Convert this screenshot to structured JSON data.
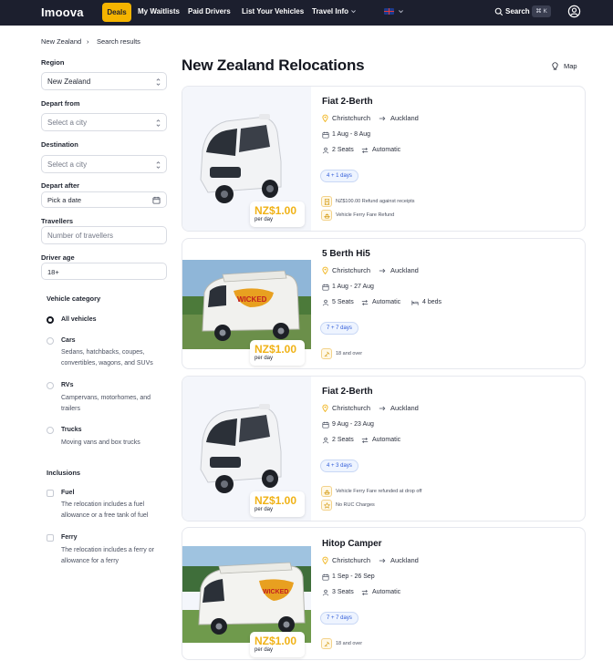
{
  "nav": {
    "logo": "Imoova",
    "deals": "Deals",
    "waitlists": "My Waitlists",
    "paid_drivers": "Paid Drivers",
    "list_vehicles": "List Your Vehicles",
    "travel_info": "Travel Info",
    "search": "Search",
    "shortcut": "⌘ K"
  },
  "breadcrumb": {
    "home": "New Zealand",
    "sep": "›",
    "current": "Search results"
  },
  "filters": {
    "region_label": "Region",
    "region_value": "New Zealand",
    "depart_from_label": "Depart from",
    "depart_from_placeholder": "Select a city",
    "destination_label": "Destination",
    "destination_placeholder": "Select a city",
    "depart_after_label": "Depart after",
    "depart_after_placeholder": "Pick a date",
    "travellers_label": "Travellers",
    "travellers_placeholder": "Number of travellers",
    "driver_age_label": "Driver age",
    "driver_age_value": "18+"
  },
  "vehicle_category": {
    "heading": "Vehicle category",
    "options": [
      {
        "title": "All vehicles",
        "desc": ""
      },
      {
        "title": "Cars",
        "desc": "Sedans, hatchbacks, coupes, convertibles, wagons, and SUVs"
      },
      {
        "title": "RVs",
        "desc": "Campervans, motorhomes, and trailers"
      },
      {
        "title": "Trucks",
        "desc": "Moving vans and box trucks"
      }
    ]
  },
  "inclusions": {
    "heading": "Inclusions",
    "options": [
      {
        "title": "Fuel",
        "desc": "The relocation includes a fuel allowance or a free tank of fuel"
      },
      {
        "title": "Ferry",
        "desc": "The relocation includes a ferry or allowance for a ferry"
      }
    ]
  },
  "main": {
    "title": "New Zealand Relocations",
    "map": "Map"
  },
  "listings": [
    {
      "title": "Fiat 2-Berth",
      "from": "Christchurch",
      "to": "Auckland",
      "dates": "1 Aug - 8 Aug",
      "seats": "2 Seats",
      "transmission": "Automatic",
      "beds": "",
      "days": "4 + 1 days",
      "price": "NZ$1.00",
      "per": "per day",
      "perks": [
        {
          "icon": "receipt-icon",
          "text": "NZ$100.00   Refund against receipts"
        },
        {
          "icon": "ferry-icon",
          "text": "Vehicle Ferry Fare Refund"
        }
      ]
    },
    {
      "title": "5 Berth Hi5",
      "from": "Christchurch",
      "to": "Auckland",
      "dates": "1 Aug - 27 Aug",
      "seats": "5 Seats",
      "transmission": "Automatic",
      "beds": "4 beds",
      "days": "7 + 7 days",
      "price": "NZ$1.00",
      "per": "per day",
      "perks": [
        {
          "icon": "age-icon",
          "text": "18 and over"
        }
      ]
    },
    {
      "title": "Fiat 2-Berth",
      "from": "Christchurch",
      "to": "Auckland",
      "dates": "9 Aug - 23 Aug",
      "seats": "2 Seats",
      "transmission": "Automatic",
      "beds": "",
      "days": "4 + 3 days",
      "price": "NZ$1.00",
      "per": "per day",
      "perks": [
        {
          "icon": "ferry-icon",
          "text": "Vehicle Ferry Fare refunded at drop off"
        },
        {
          "icon": "star-icon",
          "text": "No RUC Charges"
        }
      ]
    },
    {
      "title": "Hitop Camper",
      "from": "Christchurch",
      "to": "Auckland",
      "dates": "1 Sep - 26 Sep",
      "seats": "3 Seats",
      "transmission": "Automatic",
      "beds": "",
      "days": "7 + 7 days",
      "price": "NZ$1.00",
      "per": "per day",
      "perks": [
        {
          "icon": "age-icon",
          "text": "18 and over"
        }
      ]
    }
  ],
  "colors": {
    "nav_bg": "#1c1f2e",
    "accent": "#f5b400",
    "price": "#f0b216",
    "badge_blue": "#2f5bd8"
  }
}
